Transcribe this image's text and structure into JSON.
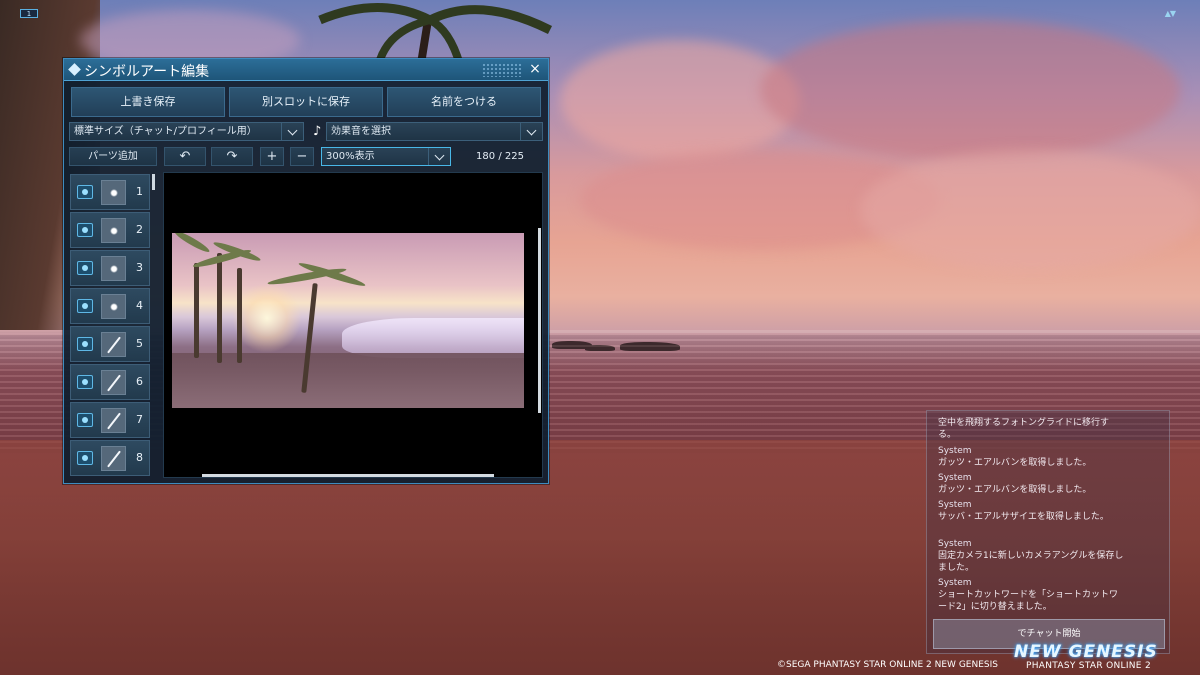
{
  "hud": {
    "top_left_badge": "1",
    "top_right_indicator": "▲▼"
  },
  "editor": {
    "title": "シンボルアート編集",
    "close_symbol": "×",
    "buttons": {
      "overwrite_save": "上書き保存",
      "save_to_other_slot": "別スロットに保存",
      "name_it": "名前をつける"
    },
    "size_select": "標準サイズ（チャット/プロフィール用）",
    "sound_icon": "♪",
    "sound_select": "効果音を選択",
    "toolbar": {
      "add_parts": "パーツ追加",
      "undo": "↶",
      "redo": "↷",
      "zoom_in": "+",
      "zoom_out": "−",
      "zoom_select": "300%表示",
      "part_count": "180 / 225"
    },
    "layers": [
      {
        "num": "1",
        "thumb": "dot"
      },
      {
        "num": "2",
        "thumb": "dot"
      },
      {
        "num": "3",
        "thumb": "dot"
      },
      {
        "num": "4",
        "thumb": "dot"
      },
      {
        "num": "5",
        "thumb": "slash"
      },
      {
        "num": "6",
        "thumb": "slash"
      },
      {
        "num": "7",
        "thumb": "slash"
      },
      {
        "num": "8",
        "thumb": "slash"
      }
    ]
  },
  "chat": {
    "lines": [
      {
        "type": "msg",
        "text": "空中を飛翔するフォトングライドに移行する。"
      },
      {
        "type": "sys",
        "text": "System"
      },
      {
        "type": "msg",
        "text": "ガッツ・エアルバンを取得しました。"
      },
      {
        "type": "sys",
        "text": "System"
      },
      {
        "type": "msg",
        "text": "ガッツ・エアルバンを取得しました。"
      },
      {
        "type": "sys",
        "text": "System"
      },
      {
        "type": "msg",
        "text": "サッバ・エアルサザイエを取得しました。"
      },
      {
        "type": "sys",
        "text": "System"
      },
      {
        "type": "msg",
        "text": "固定カメラ1に新しいカメラアングルを保存しました。"
      },
      {
        "type": "sys",
        "text": "System"
      },
      {
        "type": "msg",
        "text": "ショートカットワードを「ショートカットワード2」に切り替えました。"
      }
    ],
    "start_button": "でチャット開始"
  },
  "footer": {
    "copyright": "©SEGA PHANTASY STAR ONLINE 2 NEW GENESIS",
    "logo_line1": "NEW GENESIS",
    "logo_line2": "PHANTASY STAR ONLINE 2"
  },
  "colors": {
    "window_bg": "#0e1e2e",
    "window_border": "#3d8bbf",
    "title_bar": "#2c6e98",
    "accent": "#49b8e8"
  }
}
